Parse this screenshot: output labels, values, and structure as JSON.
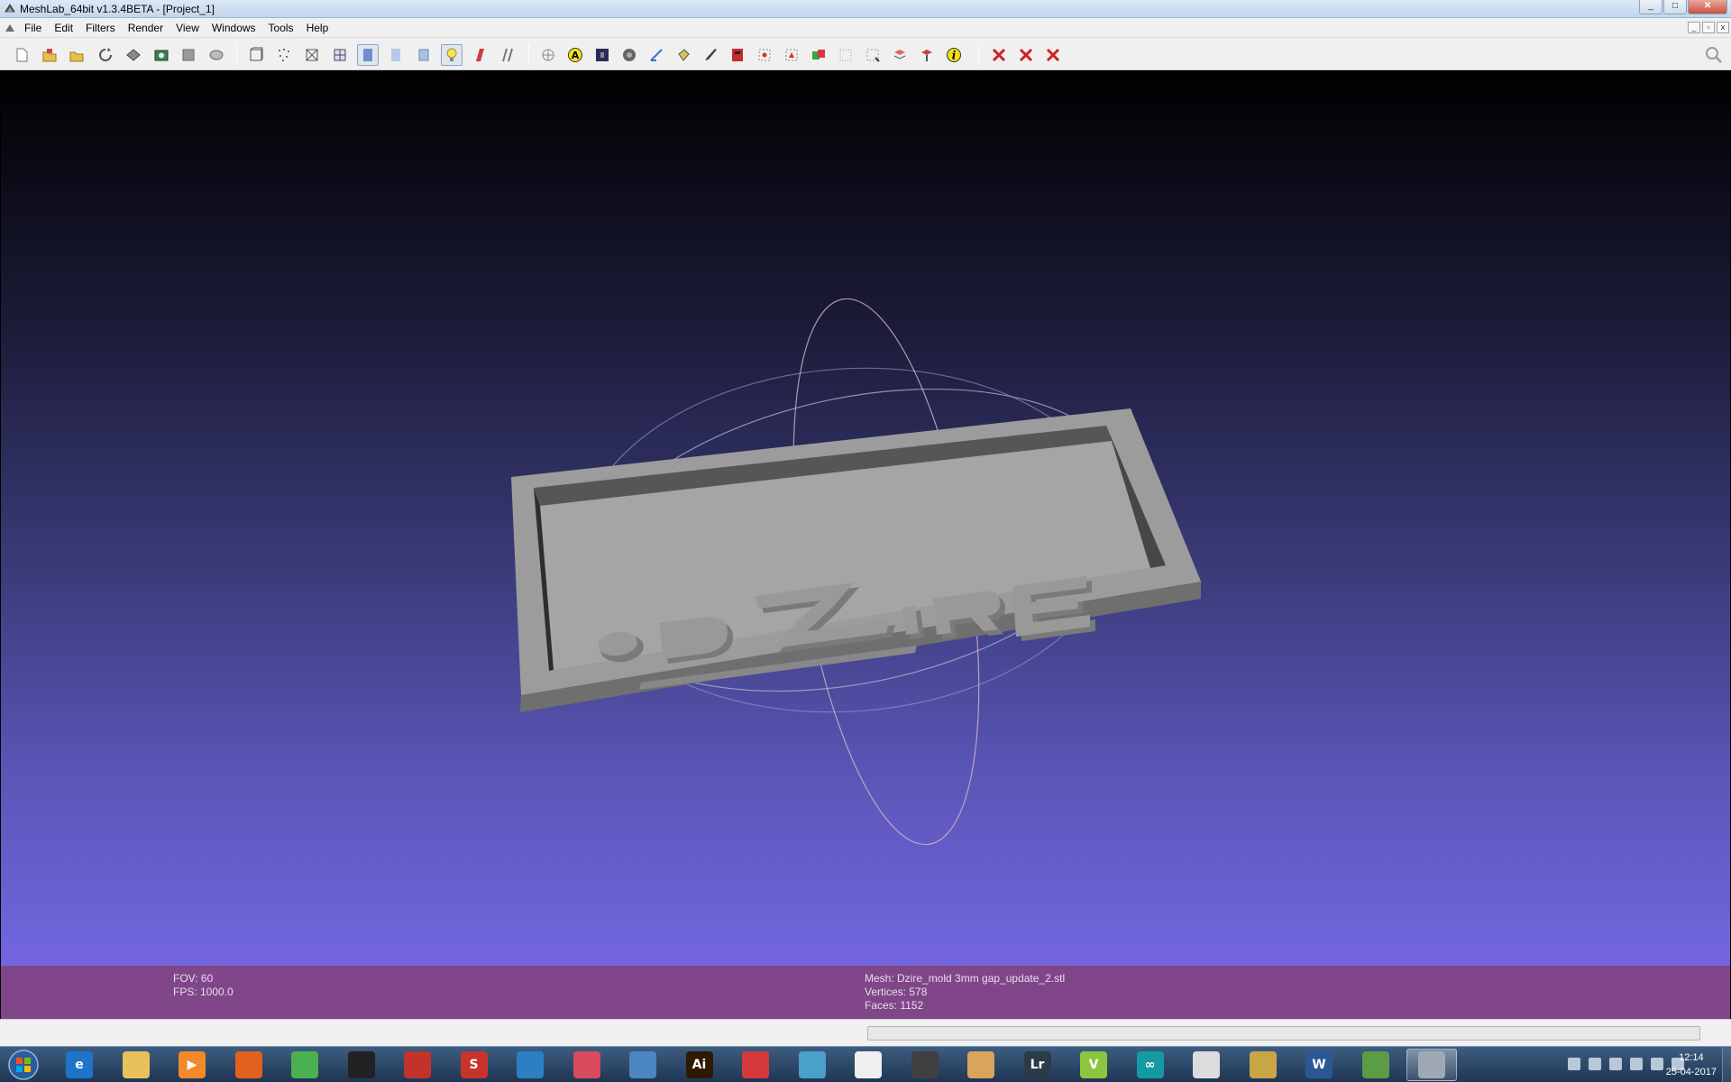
{
  "window": {
    "title": "MeshLab_64bit v1.3.4BETA - [Project_1]",
    "controls": [
      "_",
      "□",
      "✕"
    ]
  },
  "menu": {
    "items": [
      "File",
      "Edit",
      "Filters",
      "Render",
      "View",
      "Windows",
      "Tools",
      "Help"
    ],
    "mdi_controls": [
      "_",
      "▫",
      "x"
    ]
  },
  "toolbar": {
    "icons": [
      "new-project-icon",
      "open-project-icon",
      "import-mesh-icon",
      "reload-icon",
      "export-mesh-icon",
      "snapshot-icon",
      "layer-icon",
      "layers-stack-icon",
      "bounding-box-icon",
      "points-icon",
      "wireframe-icon",
      "hidden-lines-icon",
      "flat-shading-icon",
      "smooth-shading-icon",
      "texture-icon",
      "light-bulb-icon",
      "double-side-icon",
      "fancy-light-icon",
      "manipulator-icon",
      "annotate-icon",
      "raster-icon",
      "align-icon",
      "measure-icon",
      "paint-bucket-icon",
      "brush-icon",
      "paint-red-icon",
      "select-vertices-icon",
      "select-faces-icon",
      "select-color-icon",
      "select-connected-icon",
      "select-rect-icon",
      "z-painting-icon",
      "edit-paint-icon",
      "info-icon",
      "delete-selection-icon",
      "delete-vertices-icon",
      "delete-faces-icon"
    ]
  },
  "viewport": {
    "model_text": "DZIRE"
  },
  "info": {
    "fov": "FOV: 60",
    "fps": "FPS:  1000.0",
    "mesh": "Mesh: Dzire_mold 3mm gap_update_2.stl",
    "vertices": "Vertices: 578",
    "faces": "Faces: 1152"
  },
  "taskbar": {
    "apps": [
      {
        "name": "internet-explorer-icon",
        "glyph": "e",
        "color": "#1e74c8"
      },
      {
        "name": "file-explorer-icon",
        "glyph": "",
        "color": "#e7c15a"
      },
      {
        "name": "media-player-icon",
        "glyph": "▶",
        "color": "#f08a2a"
      },
      {
        "name": "firefox-icon",
        "glyph": "",
        "color": "#e2611f"
      },
      {
        "name": "chrome-icon",
        "glyph": "",
        "color": "#4caf50"
      },
      {
        "name": "app-dark-icon",
        "glyph": "",
        "color": "#222222"
      },
      {
        "name": "app-red-swirl-icon",
        "glyph": "",
        "color": "#c2332b"
      },
      {
        "name": "sketchup-icon",
        "glyph": "S",
        "color": "#c8342c"
      },
      {
        "name": "app-blue-gear-icon",
        "glyph": "",
        "color": "#2d7fc4"
      },
      {
        "name": "app-pink-cube-icon",
        "glyph": "",
        "color": "#d84b5e"
      },
      {
        "name": "app-blue-window-icon",
        "glyph": "",
        "color": "#4b86c0"
      },
      {
        "name": "illustrator-icon",
        "glyph": "Ai",
        "color": "#2e1a02"
      },
      {
        "name": "app-red-box-icon",
        "glyph": "",
        "color": "#d53a3a"
      },
      {
        "name": "app-flower-icon",
        "glyph": "",
        "color": "#49a0c9"
      },
      {
        "name": "app-white-tool-icon",
        "glyph": "",
        "color": "#efefef"
      },
      {
        "name": "app-hat-icon",
        "glyph": "",
        "color": "#3f3f3f"
      },
      {
        "name": "app-doc-icon",
        "glyph": "",
        "color": "#d9a45b"
      },
      {
        "name": "lightroom-icon",
        "glyph": "Lr",
        "color": "#2b3b4a"
      },
      {
        "name": "app-green-v-icon",
        "glyph": "V",
        "color": "#8cc63f"
      },
      {
        "name": "arduino-icon",
        "glyph": "∞",
        "color": "#159aa1"
      },
      {
        "name": "app-presentation-icon",
        "glyph": "",
        "color": "#dcdcdc"
      },
      {
        "name": "app-ruler-icon",
        "glyph": "",
        "color": "#c9a645"
      },
      {
        "name": "word-icon",
        "glyph": "W",
        "color": "#2b5797"
      },
      {
        "name": "app-chart-icon",
        "glyph": "",
        "color": "#5c9c46"
      },
      {
        "name": "meshlab-taskbar-icon",
        "glyph": "",
        "color": "#9fa9b3"
      }
    ],
    "clock_time": "12:14",
    "clock_date": "25-04-2017"
  }
}
